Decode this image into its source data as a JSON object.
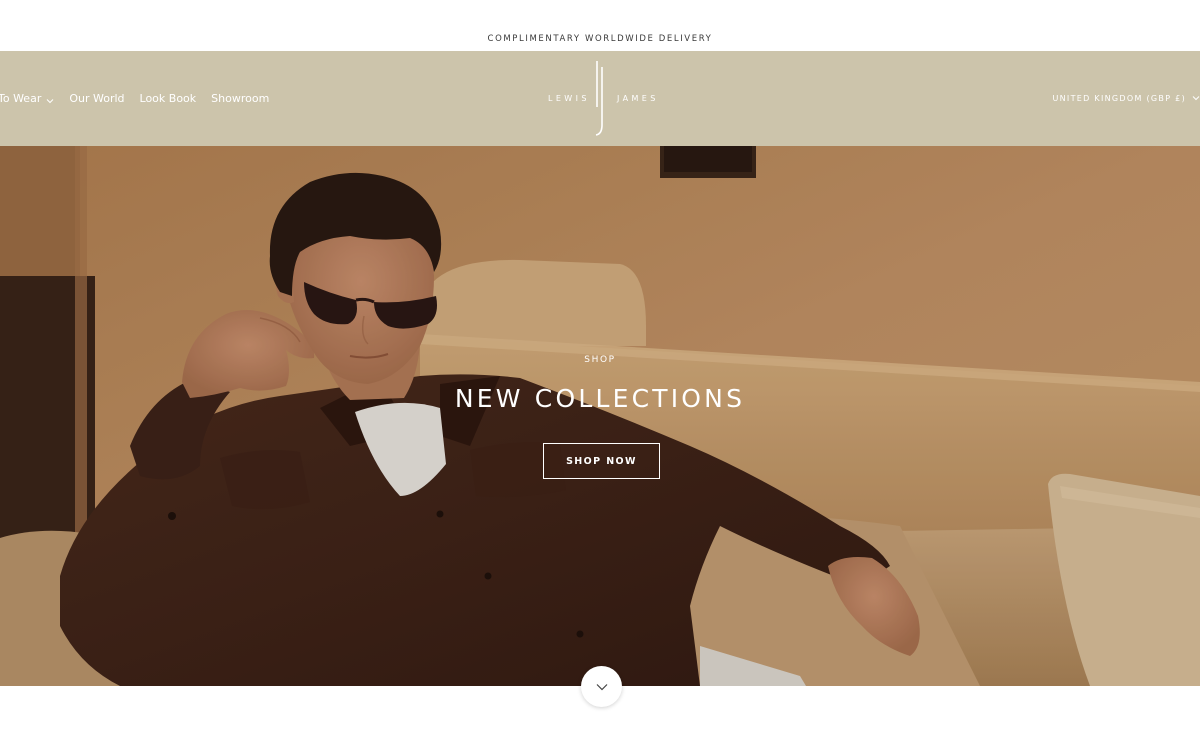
{
  "announcement": {
    "text": "COMPLIMENTARY WORLDWIDE DELIVERY"
  },
  "header": {
    "nav": [
      {
        "label": "To Wear",
        "has_dropdown": true
      },
      {
        "label": "Our World",
        "has_dropdown": false
      },
      {
        "label": "Look Book",
        "has_dropdown": false
      },
      {
        "label": "Showroom",
        "has_dropdown": false
      }
    ],
    "logo": {
      "left_word": "LEWIS",
      "right_word": "JAMES"
    },
    "country_selector": "UNITED KINGDOM (GBP £)",
    "background": "#ccc4ab"
  },
  "hero": {
    "eyebrow": "SHOP",
    "headline": "NEW COLLECTIONS",
    "cta_label": "SHOP NOW"
  },
  "icons": {
    "nav_dropdown": "chevron-down-icon",
    "country_dropdown": "chevron-down-icon",
    "scroll_down": "chevron-down-icon"
  },
  "colors": {
    "accent": "#ccc4ab",
    "text_on_accent": "#ffffff",
    "announcement_text": "#3a3a3a"
  }
}
